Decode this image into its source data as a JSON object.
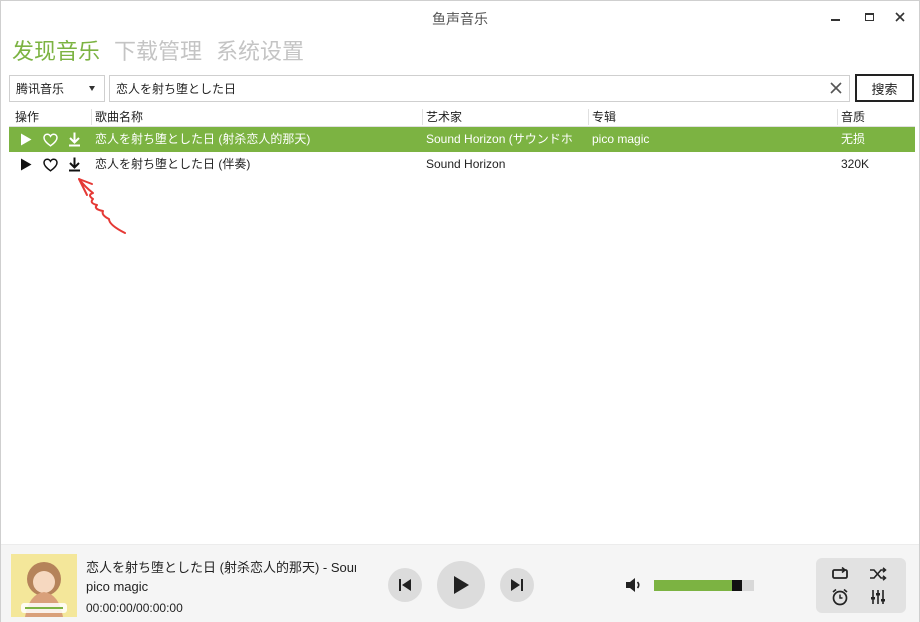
{
  "window": {
    "title": "鱼声音乐"
  },
  "tabs": [
    {
      "label": "发现音乐",
      "active": true
    },
    {
      "label": "下载管理",
      "active": false
    },
    {
      "label": "系统设置",
      "active": false
    }
  ],
  "search": {
    "source": "腾讯音乐",
    "query": "恋人を射ち堕とした日",
    "button_label": "搜索"
  },
  "table": {
    "columns": [
      "操作",
      "歌曲名称",
      "艺术家",
      "专辑",
      "音质"
    ],
    "rows": [
      {
        "title": "恋人を射ち堕とした日 (射杀恋人的那天)",
        "artist": "Sound Horizon (サウンドホ",
        "album": "pico magic",
        "quality": "无损",
        "selected": true
      },
      {
        "title": "恋人を射ち堕とした日 (伴奏)",
        "artist": "Sound Horizon",
        "album": "",
        "quality": "320K",
        "selected": false
      }
    ]
  },
  "player": {
    "now_playing_title": "恋人を射ち堕とした日 (射杀恋人的那天) - Sound",
    "album": "pico magic",
    "time": "00:00:00/00:00:00",
    "volume_level": 0.78
  },
  "colors": {
    "accent": "#7cb342",
    "annotation": "#e53935"
  },
  "icons": {
    "row_actions": [
      "play-icon",
      "heart-icon",
      "download-icon"
    ],
    "transport": [
      "previous-icon",
      "play-icon",
      "next-icon"
    ],
    "modes": [
      "repeat-icon",
      "shuffle-icon",
      "alarm-icon",
      "equalizer-icon"
    ]
  }
}
